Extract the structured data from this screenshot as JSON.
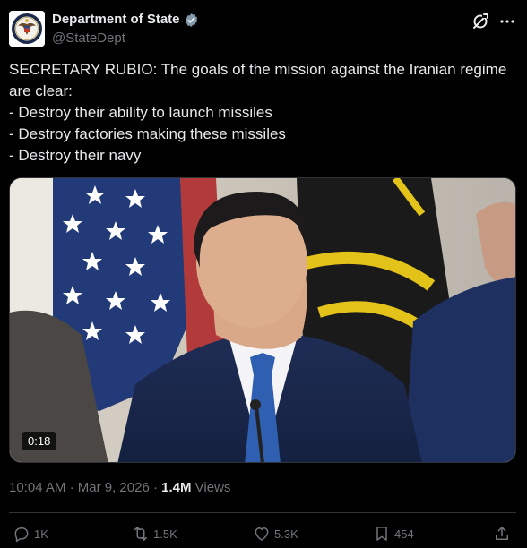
{
  "account": {
    "display_name": "Department of State",
    "handle": "@StateDept",
    "verified": true,
    "verified_badge_color": "#829aab",
    "avatar_icon": "department-of-state-seal"
  },
  "tweet": {
    "lines": [
      "SECRETARY RUBIO: The goals of the mission against the Iranian regime are clear:",
      "- Destroy their ability to launch missiles",
      "- Destroy factories making these missiles",
      "- Destroy their navy"
    ]
  },
  "media": {
    "duration": "0:18"
  },
  "meta": {
    "time": "10:04 AM",
    "date": "Mar 9, 2026",
    "views_count": "1.4M",
    "views_label": "Views"
  },
  "actions": {
    "replies": "1K",
    "reposts": "1.5K",
    "likes": "5.3K",
    "bookmarks": "454"
  },
  "icons": {
    "grok": "grok-icon",
    "more": "more-icon",
    "reply": "reply-icon",
    "repost": "repost-icon",
    "like": "heart-icon",
    "bookmark": "bookmark-icon",
    "share": "share-icon"
  },
  "colors": {
    "background": "#000000",
    "text_primary": "#e7e9ea",
    "text_secondary": "#71767b"
  }
}
